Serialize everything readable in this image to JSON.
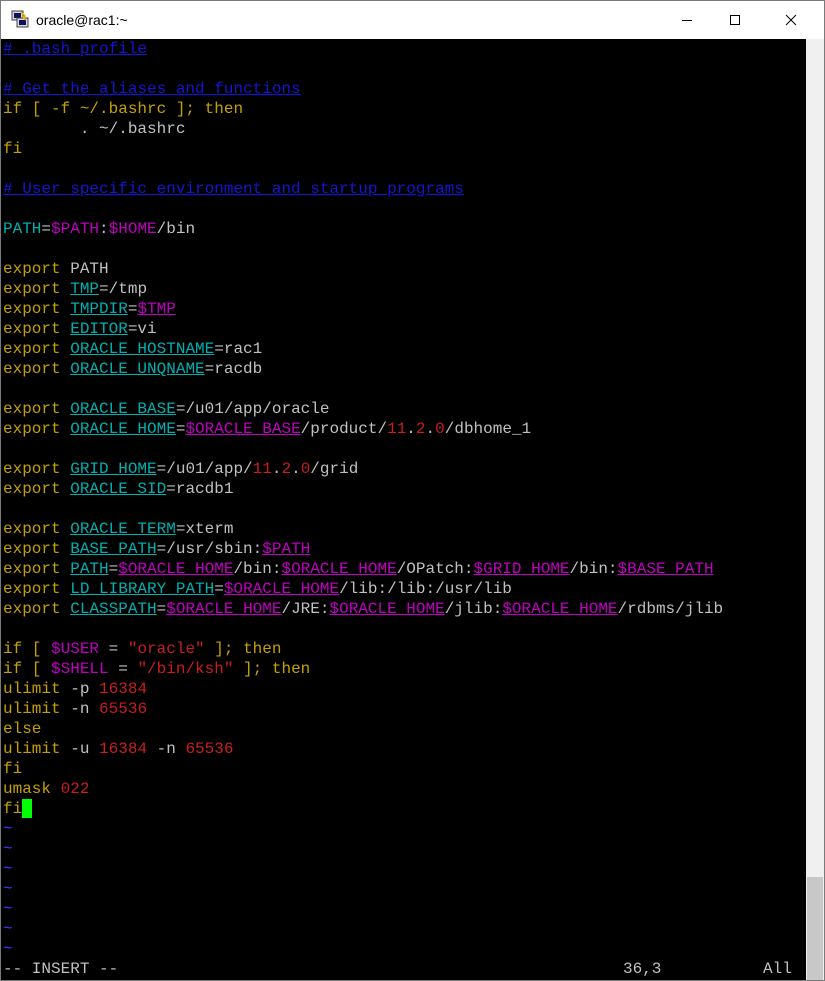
{
  "window": {
    "title": "oracle@rac1:~"
  },
  "file_lines": [
    [
      {
        "t": "# .bash_profile",
        "c": "cm"
      }
    ],
    [],
    [
      {
        "t": "# Get the aliases and functions",
        "c": "cm"
      }
    ],
    [
      {
        "t": "if [ -f ~/.bashrc ]; then",
        "c": "kw"
      }
    ],
    [
      {
        "t": "        . ~/.bashrc",
        "c": "tx"
      }
    ],
    [
      {
        "t": "fi",
        "c": "kw"
      }
    ],
    [],
    [
      {
        "t": "# User specific environment and startup programs",
        "c": "cm"
      }
    ],
    [],
    [
      {
        "t": "PATH",
        "c": "cy"
      },
      {
        "t": "=",
        "c": "tx"
      },
      {
        "t": "$PATH",
        "c": "mg"
      },
      {
        "t": ":",
        "c": "tx"
      },
      {
        "t": "$HOME",
        "c": "mg"
      },
      {
        "t": "/bin",
        "c": "tx"
      }
    ],
    [],
    [
      {
        "t": "export ",
        "c": "kw"
      },
      {
        "t": "PATH",
        "c": "tx"
      }
    ],
    [
      {
        "t": "export ",
        "c": "kw"
      },
      {
        "t": "TMP",
        "c": "cy"
      },
      {
        "t": "=/tmp",
        "c": "tx"
      }
    ],
    [
      {
        "t": "export ",
        "c": "kw"
      },
      {
        "t": "TMPDIR",
        "c": "cy"
      },
      {
        "t": "=",
        "c": "tx"
      },
      {
        "t": "$TMP",
        "c": "mg"
      }
    ],
    [
      {
        "t": "export ",
        "c": "kw"
      },
      {
        "t": "EDITOR",
        "c": "cy"
      },
      {
        "t": "=vi",
        "c": "tx"
      }
    ],
    [
      {
        "t": "export ",
        "c": "kw"
      },
      {
        "t": "ORACLE_HOSTNAME",
        "c": "cy"
      },
      {
        "t": "=rac1",
        "c": "tx"
      }
    ],
    [
      {
        "t": "export ",
        "c": "kw"
      },
      {
        "t": "ORACLE_UNQNAME",
        "c": "cy"
      },
      {
        "t": "=racdb",
        "c": "tx"
      }
    ],
    [],
    [
      {
        "t": "export ",
        "c": "kw"
      },
      {
        "t": "ORACLE_BASE",
        "c": "cy"
      },
      {
        "t": "=/u01/app/oracle",
        "c": "tx"
      }
    ],
    [
      {
        "t": "export ",
        "c": "kw"
      },
      {
        "t": "ORACLE_HOME",
        "c": "cy"
      },
      {
        "t": "=",
        "c": "tx"
      },
      {
        "t": "$ORACLE_BASE",
        "c": "mg"
      },
      {
        "t": "/product/",
        "c": "tx"
      },
      {
        "t": "11",
        "c": "rd"
      },
      {
        "t": ".",
        "c": "tx"
      },
      {
        "t": "2",
        "c": "rd"
      },
      {
        "t": ".",
        "c": "tx"
      },
      {
        "t": "0",
        "c": "rd"
      },
      {
        "t": "/dbhome_1",
        "c": "tx"
      }
    ],
    [],
    [
      {
        "t": "export ",
        "c": "kw"
      },
      {
        "t": "GRID_HOME",
        "c": "cy"
      },
      {
        "t": "=/u01/app/",
        "c": "tx"
      },
      {
        "t": "11",
        "c": "rd"
      },
      {
        "t": ".",
        "c": "tx"
      },
      {
        "t": "2",
        "c": "rd"
      },
      {
        "t": ".",
        "c": "tx"
      },
      {
        "t": "0",
        "c": "rd"
      },
      {
        "t": "/grid",
        "c": "tx"
      }
    ],
    [
      {
        "t": "export ",
        "c": "kw"
      },
      {
        "t": "ORACLE_SID",
        "c": "cy"
      },
      {
        "t": "=racdb1",
        "c": "tx"
      }
    ],
    [],
    [
      {
        "t": "export ",
        "c": "kw"
      },
      {
        "t": "ORACLE_TERM",
        "c": "cy"
      },
      {
        "t": "=xterm",
        "c": "tx"
      }
    ],
    [
      {
        "t": "export ",
        "c": "kw"
      },
      {
        "t": "BASE_PATH",
        "c": "cy"
      },
      {
        "t": "=/usr/sbin:",
        "c": "tx"
      },
      {
        "t": "$PATH",
        "c": "mg"
      }
    ],
    [
      {
        "t": "export ",
        "c": "kw"
      },
      {
        "t": "PATH",
        "c": "cy"
      },
      {
        "t": "=",
        "c": "tx"
      },
      {
        "t": "$ORACLE_HOME",
        "c": "mg"
      },
      {
        "t": "/bin:",
        "c": "tx"
      },
      {
        "t": "$ORACLE_HOME",
        "c": "mg"
      },
      {
        "t": "/OPatch:",
        "c": "tx"
      },
      {
        "t": "$GRID_HOME",
        "c": "mg"
      },
      {
        "t": "/bin:",
        "c": "tx"
      },
      {
        "t": "$BASE_PATH",
        "c": "mg"
      }
    ],
    [
      {
        "t": "export ",
        "c": "kw"
      },
      {
        "t": "LD_LIBRARY_PATH",
        "c": "cy"
      },
      {
        "t": "=",
        "c": "tx"
      },
      {
        "t": "$ORACLE_HOME",
        "c": "mg"
      },
      {
        "t": "/lib:/lib:/usr/lib",
        "c": "tx"
      }
    ],
    [
      {
        "t": "export ",
        "c": "kw"
      },
      {
        "t": "CLASSPATH",
        "c": "cy"
      },
      {
        "t": "=",
        "c": "tx"
      },
      {
        "t": "$ORACLE_HOME",
        "c": "mg"
      },
      {
        "t": "/JRE:",
        "c": "tx"
      },
      {
        "t": "$ORACLE_HOME",
        "c": "mg"
      },
      {
        "t": "/jlib:",
        "c": "tx"
      },
      {
        "t": "$ORACLE_HOME",
        "c": "mg"
      },
      {
        "t": "/rdbms/jlib",
        "c": "tx"
      }
    ],
    [],
    [
      {
        "t": "if [ ",
        "c": "kw"
      },
      {
        "t": "$USER",
        "c": "mg"
      },
      {
        "t": " = ",
        "c": "tx"
      },
      {
        "t": "\"oracle\"",
        "c": "rd"
      },
      {
        "t": " ]; then",
        "c": "kw"
      }
    ],
    [
      {
        "t": "if [ ",
        "c": "kw"
      },
      {
        "t": "$SHELL",
        "c": "mg"
      },
      {
        "t": " = ",
        "c": "tx"
      },
      {
        "t": "\"/bin/ksh\"",
        "c": "rd"
      },
      {
        "t": " ]; then",
        "c": "kw"
      }
    ],
    [
      {
        "t": "ulimit ",
        "c": "kw"
      },
      {
        "t": "-p ",
        "c": "tx"
      },
      {
        "t": "16384",
        "c": "rd"
      }
    ],
    [
      {
        "t": "ulimit ",
        "c": "kw"
      },
      {
        "t": "-n ",
        "c": "tx"
      },
      {
        "t": "65536",
        "c": "rd"
      }
    ],
    [
      {
        "t": "else",
        "c": "kw"
      }
    ],
    [
      {
        "t": "ulimit ",
        "c": "kw"
      },
      {
        "t": "-u ",
        "c": "tx"
      },
      {
        "t": "16384",
        "c": "rd"
      },
      {
        "t": " -n ",
        "c": "tx"
      },
      {
        "t": "65536",
        "c": "rd"
      }
    ],
    [
      {
        "t": "fi",
        "c": "kw"
      }
    ],
    [
      {
        "t": "umask ",
        "c": "kw"
      },
      {
        "t": "022",
        "c": "rd"
      }
    ],
    [
      {
        "t": "fi",
        "c": "kw"
      },
      {
        "cursor": true
      }
    ],
    [
      {
        "t": "~",
        "c": "tl"
      }
    ],
    [
      {
        "t": "~",
        "c": "tl"
      }
    ],
    [
      {
        "t": "~",
        "c": "tl"
      }
    ],
    [
      {
        "t": "~",
        "c": "tl"
      }
    ],
    [
      {
        "t": "~",
        "c": "tl"
      }
    ],
    [
      {
        "t": "~",
        "c": "tl"
      }
    ],
    [
      {
        "t": "~",
        "c": "tl"
      }
    ]
  ],
  "underline_words": [
    "PATH",
    "TMP",
    "TMPDIR",
    "EDITOR",
    "ORACLE_HOSTNAME",
    "ORACLE_UNQNAME",
    "ORACLE_BASE",
    "ORACLE_HOME",
    "GRID_HOME",
    "ORACLE_SID",
    "ORACLE_TERM",
    "BASE_PATH",
    "LD_LIBRARY_PATH",
    "CLASSPATH"
  ],
  "status": {
    "mode": "-- INSERT --",
    "position": "36,3",
    "scroll": "All"
  },
  "colors": {
    "comment": "#1515d6",
    "keyword": "#c4a000",
    "identifier": "#00afaf",
    "variable": "#c000c0",
    "literal": "#c81e1e",
    "tilde": "#3c3cff",
    "text": "#c0c0c0",
    "cursor": "#00ff00"
  }
}
